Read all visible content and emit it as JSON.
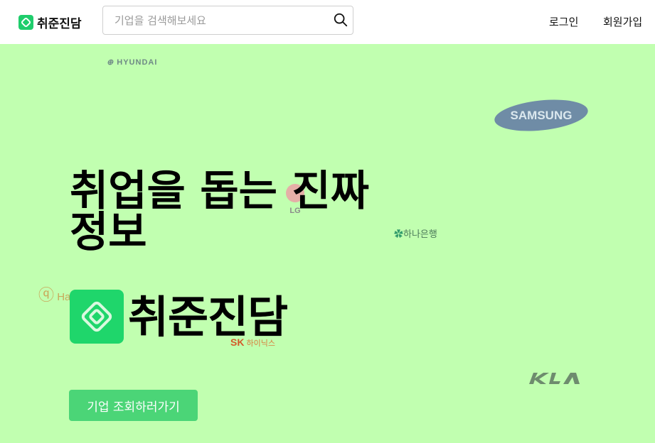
{
  "header": {
    "brand_name": "취준진담",
    "search": {
      "placeholder": "기업을 검색해보세요",
      "value": "",
      "icon": "search-icon"
    },
    "nav": {
      "login": "로그인",
      "signup": "회원가입"
    }
  },
  "hero": {
    "headline_line1": "취업을 돕는 진짜",
    "headline_line2": "정보",
    "brand_name": "취준진담",
    "cta_label": "기업 조회하러가기",
    "background_color": "#c1ffb0",
    "logos": {
      "hyundai": "HYUNDAI",
      "samsung": "SAMSUNG",
      "lg": "LG",
      "hana": "하나은행",
      "hanwha": "Ha",
      "sk_letters": "SK",
      "sk_text": "하이닉스"
    }
  },
  "colors": {
    "accent": "#1fcd6c",
    "cta": "#4bd577"
  }
}
